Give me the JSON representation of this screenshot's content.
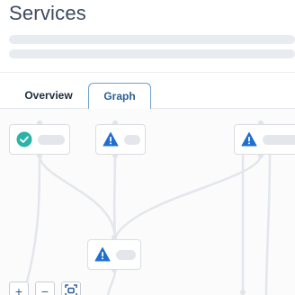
{
  "header": {
    "title": "Services"
  },
  "tabs": [
    {
      "label": "Overview",
      "active": false
    },
    {
      "label": "Graph",
      "active": true
    }
  ],
  "graph": {
    "nodes": [
      {
        "status": "ok",
        "icon": "check-circle-icon"
      },
      {
        "status": "warning",
        "icon": "warning-triangle-icon"
      },
      {
        "status": "warning",
        "icon": "warning-triangle-icon"
      },
      {
        "status": "warning",
        "icon": "warning-triangle-icon"
      }
    ]
  },
  "zoom_controls": {
    "zoom_in": "+",
    "zoom_out": "−"
  },
  "colors": {
    "accent": "#2b5f97",
    "ok": "#2bb3a8",
    "warning": "#1f6fd1"
  }
}
